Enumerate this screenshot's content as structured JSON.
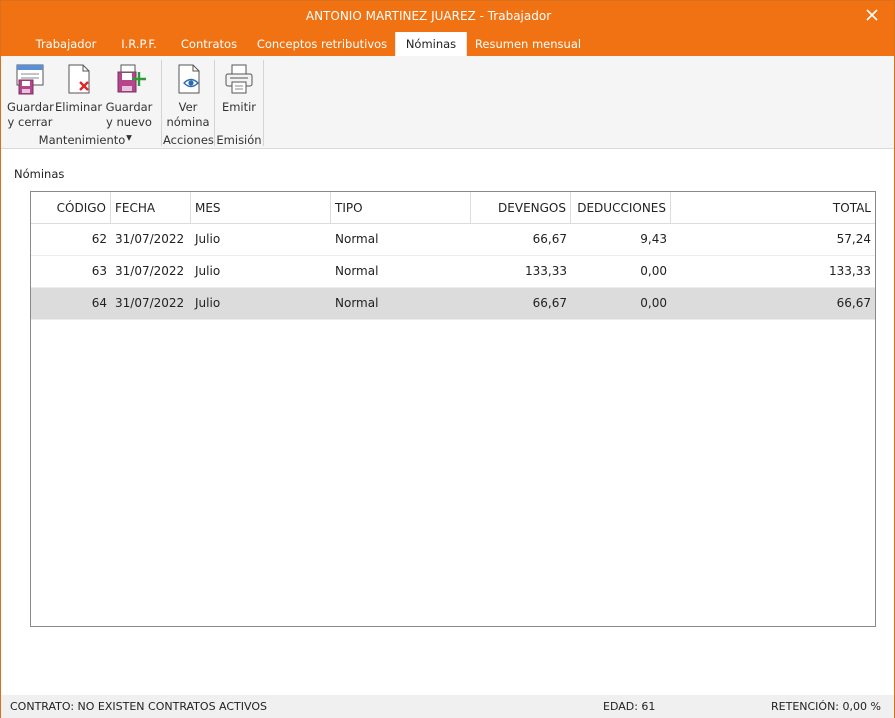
{
  "window": {
    "title": "ANTONIO MARTINEZ JUAREZ - Trabajador",
    "close_label": "✕"
  },
  "tabs": [
    {
      "label": "Trabajador"
    },
    {
      "label": "I.R.P.F."
    },
    {
      "label": "Contratos"
    },
    {
      "label": "Conceptos retributivos"
    },
    {
      "label": "Nóminas",
      "active": true
    },
    {
      "label": "Resumen mensual"
    }
  ],
  "ribbon": {
    "groups": {
      "mantenimiento": "Mantenimiento",
      "acciones": "Acciones",
      "emision": "Emisión"
    },
    "buttons": {
      "guardar_cerrar": {
        "line1": "Guardar",
        "line2": "y cerrar",
        "icon": "save-close-icon"
      },
      "eliminar": {
        "line1": "Eliminar",
        "icon": "delete-icon"
      },
      "guardar_nuevo": {
        "line1": "Guardar",
        "line2": "y nuevo ▾",
        "icon": "save-new-icon"
      },
      "ver_nomina": {
        "line1": "Ver",
        "line2": "nómina",
        "icon": "view-icon"
      },
      "emitir": {
        "line1": "Emitir",
        "icon": "printer-icon"
      }
    }
  },
  "section_title": "Nóminas",
  "table": {
    "columns": [
      "CÓDIGO",
      "FECHA",
      "MES",
      "TIPO",
      "DEVENGOS",
      "DEDUCCIONES",
      "TOTAL"
    ],
    "rows": [
      {
        "codigo": "62",
        "fecha": "31/07/2022",
        "mes": "Julio",
        "tipo": "Normal",
        "devengos": "66,67",
        "deducciones": "9,43",
        "total": "57,24"
      },
      {
        "codigo": "63",
        "fecha": "31/07/2022",
        "mes": "Julio",
        "tipo": "Normal",
        "devengos": "133,33",
        "deducciones": "0,00",
        "total": "133,33"
      },
      {
        "codigo": "64",
        "fecha": "31/07/2022",
        "mes": "Julio",
        "tipo": "Normal",
        "devengos": "66,67",
        "deducciones": "0,00",
        "total": "66,67",
        "selected": true
      }
    ]
  },
  "status": {
    "contrato": "CONTRATO: NO EXISTEN CONTRATOS ACTIVOS",
    "edad": "EDAD: 61",
    "retencion": "RETENCIÓN: 0,00 %"
  },
  "colors": {
    "accent": "#f07213",
    "selected_row": "#dcdcdc",
    "delete_red": "#e0262b",
    "add_green": "#2e9b3a"
  }
}
